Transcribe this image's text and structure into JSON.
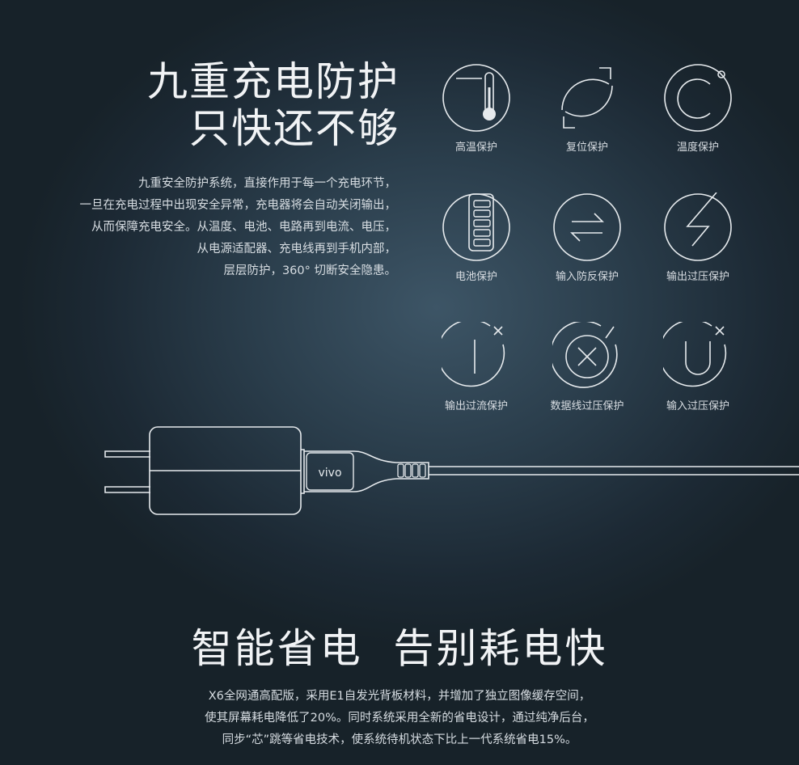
{
  "protection_section": {
    "title_line1": "九重充电防护",
    "title_line2": "只快还不够",
    "description": [
      "九重安全防护系统，直接作用于每一个充电环节，",
      "一旦在充电过程中出现安全异常，充电器将会自动关闭输出，",
      "从而保障充电安全。从温度、电池、电路再到电流、电压，",
      "从电源适配器、充电线再到手机内部，",
      "层层防护，360°  切断安全隐患。"
    ],
    "features": [
      {
        "label": "高温保护",
        "icon": "thermometer-icon"
      },
      {
        "label": "复位保护",
        "icon": "reset-icon"
      },
      {
        "label": "温度保护",
        "icon": "celsius-icon"
      },
      {
        "label": "电池保护",
        "icon": "battery-icon"
      },
      {
        "label": "输入防反保护",
        "icon": "reverse-arrows-icon"
      },
      {
        "label": "输出过压保护",
        "icon": "lightning-icon"
      },
      {
        "label": "输出过流保护",
        "icon": "current-cutoff-icon"
      },
      {
        "label": "数据线过压保护",
        "icon": "cable-cutoff-icon"
      },
      {
        "label": "输入过压保护",
        "icon": "u-cutoff-icon"
      }
    ]
  },
  "charger": {
    "brand_logo": "vivo"
  },
  "power_section": {
    "title": "智能省电  告别耗电快",
    "description": [
      "X6全网通高配版，采用E1自发光背板材料，并增加了独立图像缓存空间，",
      "使其屏幕耗电降低了20%。同时系统采用全新的省电设计，通过纯净后台，",
      "同步“芯”跳等省电技术，使系统待机状态下比上一代系统省电15%。"
    ]
  },
  "colors": {
    "background": "#24343f",
    "line": "#e6eaed",
    "text": "#f1f3f5"
  }
}
